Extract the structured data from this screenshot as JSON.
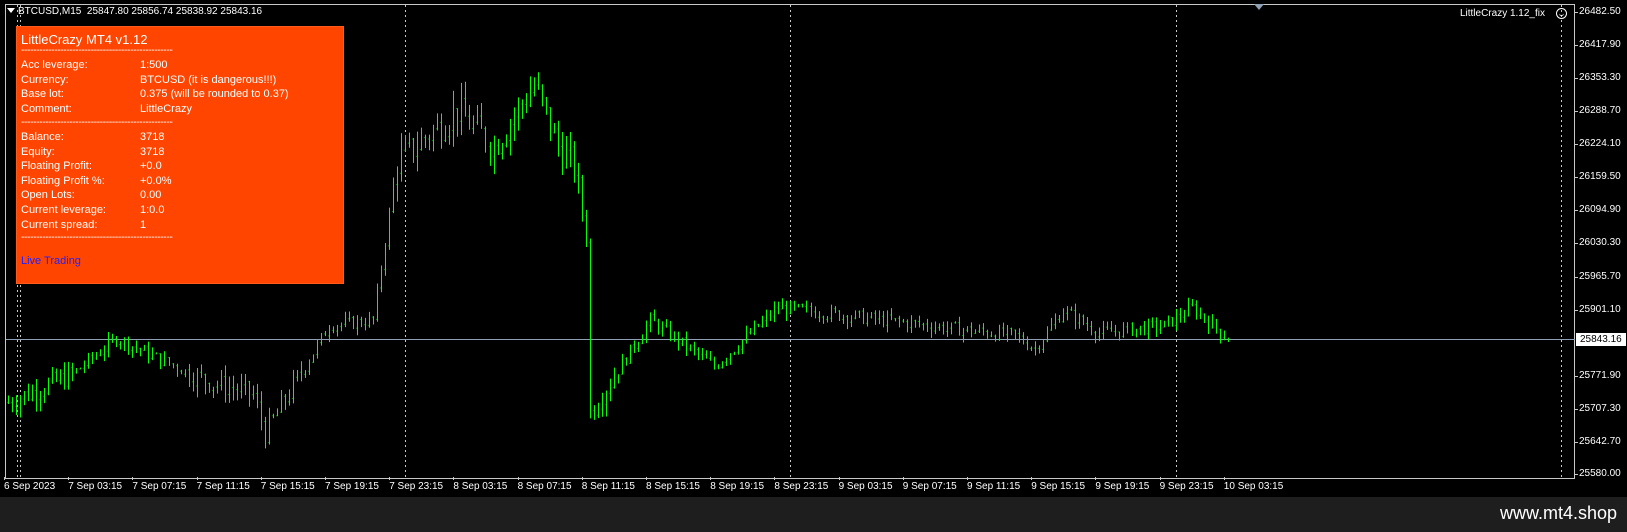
{
  "header": {
    "symbol": "BTCUSD,M15",
    "ohlc": "25847.80 25856.74 25838.92 25843.16"
  },
  "ea_label": "LittleCrazy 1.12_fix",
  "price_axis": {
    "ticks": [
      "26482.50",
      "26417.90",
      "26353.30",
      "26288.70",
      "26224.10",
      "26159.50",
      "26094.90",
      "26030.30",
      "25965.70",
      "25901.10",
      "25771.90",
      "25707.30",
      "25642.70",
      "25580.00"
    ],
    "current_price": "25843.16"
  },
  "time_axis": {
    "ticks": [
      "6 Sep 2023",
      "7 Sep 03:15",
      "7 Sep 07:15",
      "7 Sep 11:15",
      "7 Sep 15:15",
      "7 Sep 19:15",
      "7 Sep 23:15",
      "8 Sep 03:15",
      "8 Sep 07:15",
      "8 Sep 11:15",
      "8 Sep 15:15",
      "8 Sep 19:15",
      "8 Sep 23:15",
      "9 Sep 03:15",
      "9 Sep 07:15",
      "9 Sep 11:15",
      "9 Sep 15:15",
      "9 Sep 19:15",
      "9 Sep 23:15",
      "10 Sep 03:15"
    ]
  },
  "panel": {
    "title": "LittleCrazy MT4 v1.12",
    "separator": "--------------------------------------------------",
    "group1": [
      {
        "label": "Acc leverage:",
        "value": "1:500"
      },
      {
        "label": "Currency:",
        "value": "BTCUSD (it is dangerous!!!)"
      },
      {
        "label": "Base lot:",
        "value": "0.375 (will be rounded to 0.37)"
      },
      {
        "label": "Comment:",
        "value": "LittleCrazy"
      }
    ],
    "group2": [
      {
        "label": "Balance:",
        "value": "3718"
      },
      {
        "label": "Equity:",
        "value": "3718"
      },
      {
        "label": "Floating Profit:",
        "value": "+0.0"
      },
      {
        "label": "Floating Profit %:",
        "value": "+0.0%"
      },
      {
        "label": "Open Lots:",
        "value": "0.00"
      },
      {
        "label": "Current leverage:",
        "value": "1:0.0"
      },
      {
        "label": "Current spread:",
        "value": "1"
      }
    ],
    "link": "Live Trading"
  },
  "colors": {
    "candle": "#00ff00",
    "panel_bg": "#ff4500",
    "grid": "#c8c8c8",
    "price_line": "#8fa0b4",
    "link": "#1e22ff"
  },
  "chart_data": {
    "type": "candlestick",
    "symbol": "BTCUSD",
    "timeframe": "M15",
    "ylim": [
      25580.0,
      26482.5
    ],
    "current_price": 25843.16,
    "path_keypoints": [
      {
        "t": "6 Sep 2023 23:15",
        "price": 25720
      },
      {
        "t": "7 Sep 03:15",
        "price": 25775
      },
      {
        "t": "7 Sep 06:00",
        "price": 25845
      },
      {
        "t": "7 Sep 11:15",
        "price": 25765
      },
      {
        "t": "7 Sep 14:30",
        "price": 25735
      },
      {
        "t": "7 Sep 15:15",
        "price": 25660
      },
      {
        "t": "7 Sep 19:15",
        "price": 25870
      },
      {
        "t": "7 Sep 22:00",
        "price": 25880
      },
      {
        "t": "7 Sep 23:30",
        "price": 26190
      },
      {
        "t": "8 Sep 03:15",
        "price": 26290
      },
      {
        "t": "8 Sep 05:30",
        "price": 26220
      },
      {
        "t": "8 Sep 08:00",
        "price": 26340
      },
      {
        "t": "8 Sep 09:30",
        "price": 26220
      },
      {
        "t": "8 Sep 10:30",
        "price": 26180
      },
      {
        "t": "8 Sep 11:15",
        "price": 26040
      },
      {
        "t": "8 Sep 11:30",
        "price": 25700
      },
      {
        "t": "8 Sep 15:15",
        "price": 25880
      },
      {
        "t": "8 Sep 19:15",
        "price": 25790
      },
      {
        "t": "8 Sep 23:15",
        "price": 25905
      },
      {
        "t": "9 Sep 03:15",
        "price": 25890
      },
      {
        "t": "9 Sep 11:15",
        "price": 25860
      },
      {
        "t": "9 Sep 14:00",
        "price": 25850
      },
      {
        "t": "9 Sep 15:15",
        "price": 25825
      },
      {
        "t": "9 Sep 17:00",
        "price": 25900
      },
      {
        "t": "9 Sep 19:15",
        "price": 25855
      },
      {
        "t": "9 Sep 23:15",
        "price": 25870
      },
      {
        "t": "10 Sep 01:00",
        "price": 25905
      },
      {
        "t": "10 Sep 03:15",
        "price": 25843
      }
    ],
    "grid": false
  }
}
